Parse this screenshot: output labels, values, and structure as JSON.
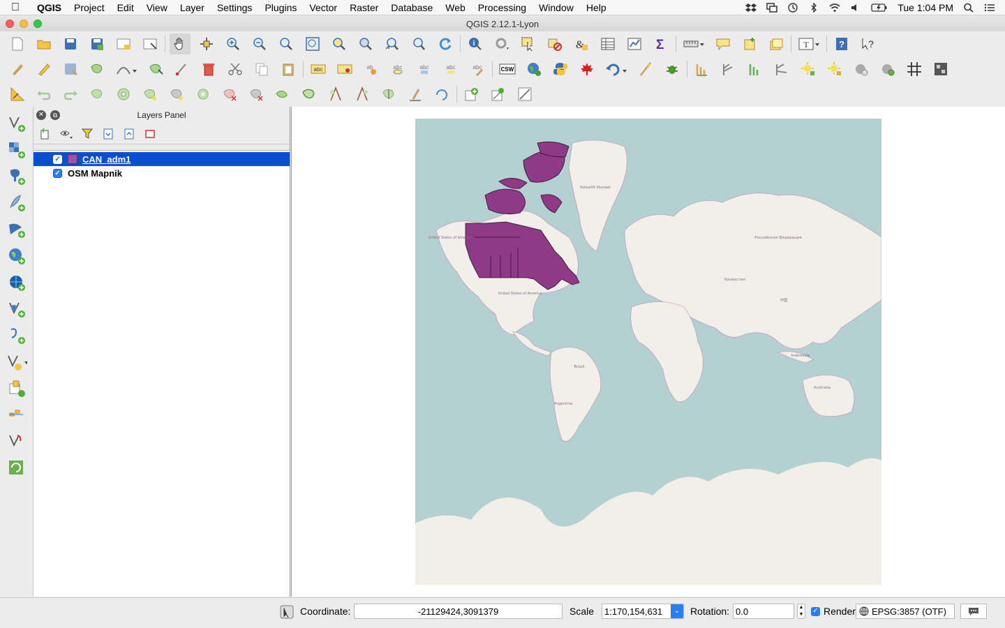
{
  "menubar": {
    "app_name": "QGIS",
    "items": [
      "Project",
      "Edit",
      "View",
      "Layer",
      "Settings",
      "Plugins",
      "Vector",
      "Raster",
      "Database",
      "Web",
      "Processing",
      "Window",
      "Help"
    ],
    "clock": "Tue 1:04 PM"
  },
  "window": {
    "title": "QGIS 2.12.1-Lyon"
  },
  "layers_panel": {
    "title": "Layers Panel",
    "layers": [
      {
        "name": "CAN_adm1",
        "visible": true,
        "selected": true,
        "color": "#a4519f"
      },
      {
        "name": "OSM Mapnik",
        "visible": true,
        "selected": false
      }
    ]
  },
  "map": {
    "labels": [
      "Kalaallit Nunaat",
      "United States of America",
      "United States of America",
      "Российская Федерация",
      "Қазақстан",
      "中国",
      "Brasil",
      "Argentina",
      "Indonesia",
      "Australia"
    ],
    "ocean_color": "#b5d0d0",
    "land_color": "#f2efe9",
    "boundary_color": "#b98eb5"
  },
  "statusbar": {
    "coordinate_label": "Coordinate:",
    "coordinate_value": "-21129424,3091379",
    "scale_label": "Scale",
    "scale_value": "1:170,154,631",
    "rotation_label": "Rotation:",
    "rotation_value": "0.0",
    "render_label": "Render",
    "crs_label": "EPSG:3857 (OTF)"
  },
  "toolbar_csw_label": "CSW"
}
